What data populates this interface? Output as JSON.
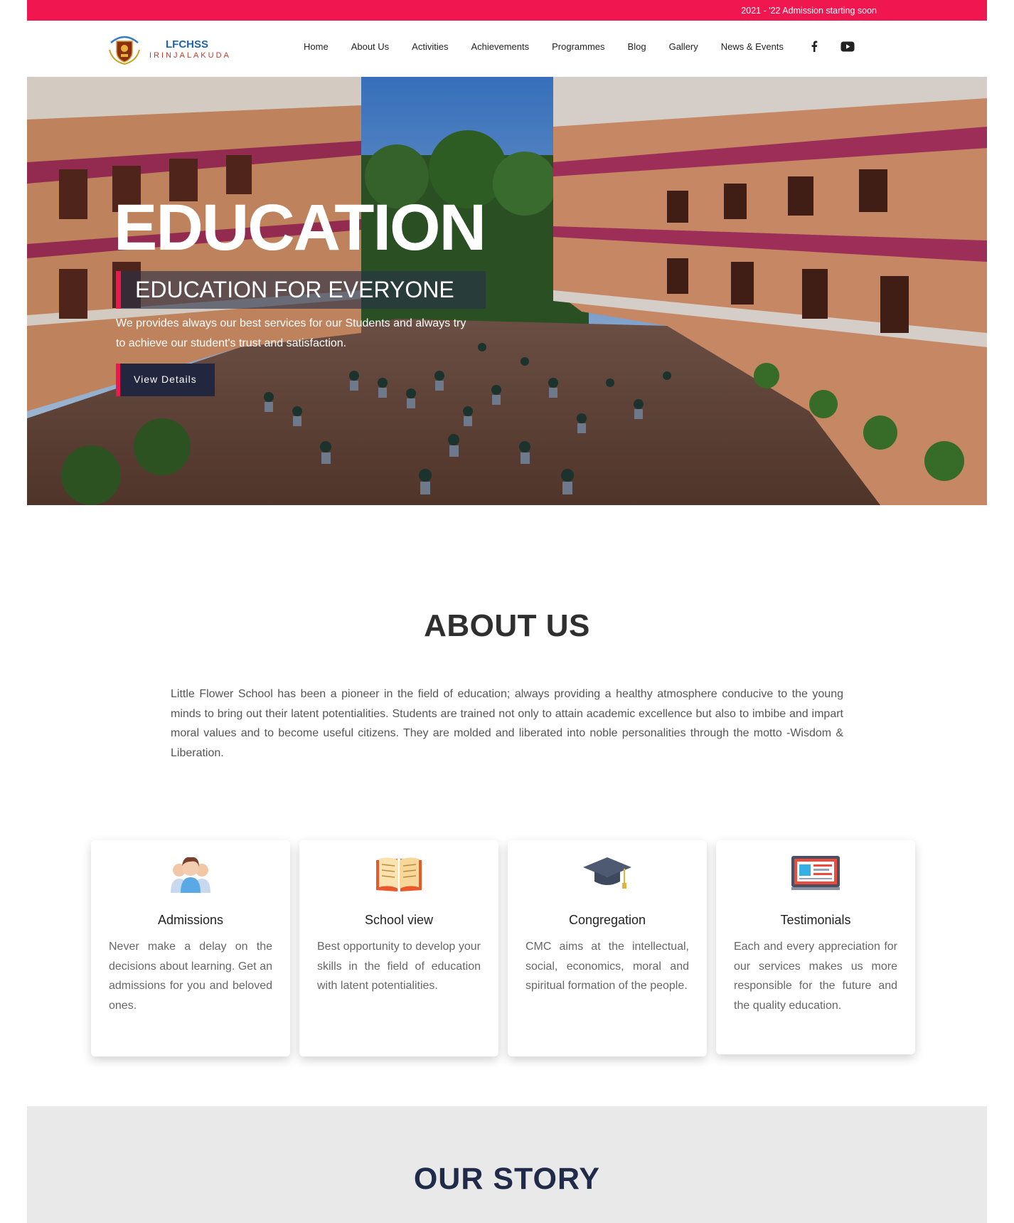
{
  "topbar": {
    "announcement": "2021 - '22 Admission starting soon"
  },
  "logo": {
    "name": "LFCHSS",
    "place": "IRINJALAKUDA",
    "emblem_icon": "school-crest-icon"
  },
  "nav": {
    "items": [
      "Home",
      "About Us",
      "Activities",
      "Achievements",
      "Programmes",
      "Blog",
      "Gallery",
      "News & Events"
    ],
    "social_icons": [
      "facebook-icon",
      "youtube-icon"
    ]
  },
  "hero": {
    "title": "EDUCATION",
    "subtitle": "EDUCATION FOR EVERYONE",
    "text": "We provides always our best services for our Students and always try to achieve our student's trust and satisfaction.",
    "button": "View Details"
  },
  "about": {
    "title": "ABOUT US",
    "text": "Little Flower School has been a pioneer in the field of education; always providing a healthy atmosphere conducive to the young minds to bring out their latent potentialities. Students are trained not only to attain academic excellence but also to imbibe and impart moral values and to become useful citizens. They are molded and liberated into noble personalities through the motto -Wisdom & Liberation."
  },
  "cards": [
    {
      "title": "Admissions",
      "icon": "students-group-icon",
      "text": "Never make a delay on the decisions about learning. Get an admissions for you and beloved ones."
    },
    {
      "title": "School view",
      "icon": "open-book-icon",
      "text": "Best opportunity to develop your skills in the field of education with latent potentialities."
    },
    {
      "title": "Congregation",
      "icon": "graduation-cap-icon",
      "text": "CMC aims at the intellectual, social, economics, moral and spiritual formation of the people."
    },
    {
      "title": "Testimonials",
      "icon": "presentation-screen-icon",
      "text": "Each and every appreciation for our services makes us more responsible for the future and the quality education."
    }
  ],
  "story": {
    "title": "OUR STORY"
  },
  "colors": {
    "accent": "#f0164f",
    "dark_navy": "#22263f",
    "story_bg": "#e9e9e9"
  }
}
